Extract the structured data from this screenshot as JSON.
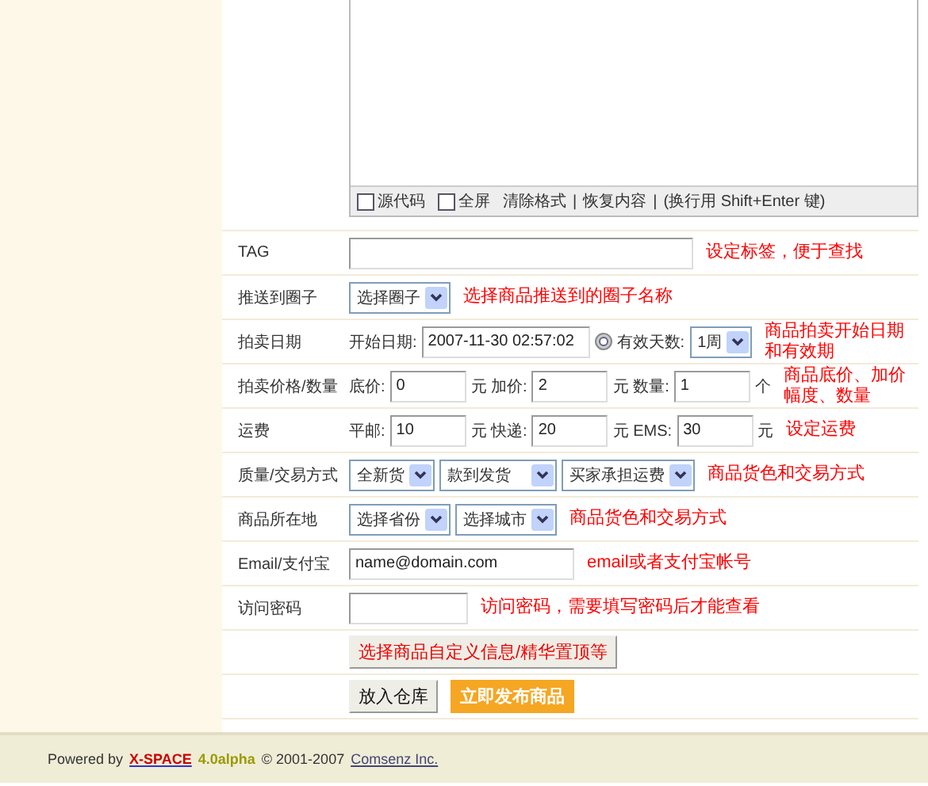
{
  "editor": {
    "toolbar": [
      {
        "kind": "checkbox",
        "label": "源代码",
        "checked": false
      },
      {
        "kind": "checkbox",
        "label": "全屏",
        "checked": false
      },
      {
        "kind": "link",
        "label": "清除格式"
      },
      {
        "kind": "text",
        "label": "|"
      },
      {
        "kind": "link",
        "label": "恢复内容"
      },
      {
        "kind": "text",
        "label": "|"
      },
      {
        "kind": "text",
        "label": "(换行用 Shift+Enter 键)"
      }
    ]
  },
  "rows": [
    {
      "label": "TAG",
      "fields": [
        {
          "kind": "wideinput"
        }
      ],
      "note": "设定标签，便于查找"
    },
    {
      "label": "推送到圈子",
      "fields": [
        {
          "kind": "select",
          "value": "选择圈子"
        }
      ],
      "note": "选择商品推送到的圈子名称"
    },
    {
      "label": "拍卖日期",
      "fields": [
        {
          "kind": "text",
          "value": "开始日期:"
        },
        {
          "kind": "dateinput",
          "value": "2007-11-30 02:57:02"
        },
        {
          "kind": "calendar"
        },
        {
          "kind": "text",
          "value": "有效天数:"
        },
        {
          "kind": "select",
          "value": "1周"
        }
      ],
      "note": "商品拍卖开始日期和有效期"
    },
    {
      "label": "拍卖价格/数量",
      "fields": [
        {
          "kind": "text",
          "value": "底价:"
        },
        {
          "kind": "input",
          "value": "0"
        },
        {
          "kind": "text",
          "value": "元 加价:"
        },
        {
          "kind": "input",
          "value": "2"
        },
        {
          "kind": "text",
          "value": "元 数量:"
        },
        {
          "kind": "input",
          "value": "1"
        },
        {
          "kind": "text",
          "value": "个"
        }
      ],
      "note": "商品底价、加价幅度、数量"
    },
    {
      "label": "运费",
      "fields": [
        {
          "kind": "text",
          "value": "平邮:"
        },
        {
          "kind": "input",
          "value": "10"
        },
        {
          "kind": "text",
          "value": "元 快递:"
        },
        {
          "kind": "input",
          "value": "20"
        },
        {
          "kind": "text",
          "value": "元 EMS:"
        },
        {
          "kind": "input",
          "value": "30"
        },
        {
          "kind": "text",
          "value": "元"
        }
      ],
      "note": "设定运费"
    },
    {
      "label": "质量/交易方式",
      "fields": [
        {
          "kind": "select",
          "value": "全新货"
        },
        {
          "kind": "select",
          "value": "款到发货　"
        },
        {
          "kind": "select",
          "value": "买家承担运费"
        }
      ],
      "note": "商品货色和交易方式"
    },
    {
      "label": "商品所在地",
      "fields": [
        {
          "kind": "select",
          "value": "选择省份"
        },
        {
          "kind": "select",
          "value": "选择城市"
        }
      ],
      "note": "商品货色和交易方式"
    },
    {
      "label": "Email/支付宝",
      "fields": [
        {
          "kind": "mediuminput",
          "value": "name@domain.com"
        }
      ],
      "note": "email或者支付宝帐号"
    },
    {
      "label": "访问密码",
      "fields": [
        {
          "kind": "smallinput"
        }
      ],
      "note": "访问密码，需要填写密码后才能查看"
    }
  ],
  "option_button": "选择商品自定义信息/精华置顶等",
  "buttons": [
    {
      "kind": "normal",
      "label": "放入仓库"
    },
    {
      "kind": "primary",
      "label": "立即发布商品"
    }
  ],
  "footer": {
    "powered": "Powered by",
    "product": "X-SPACE",
    "version": "4.0alpha",
    "copyright": "© 2001-2007",
    "company": "Comsenz Inc."
  }
}
